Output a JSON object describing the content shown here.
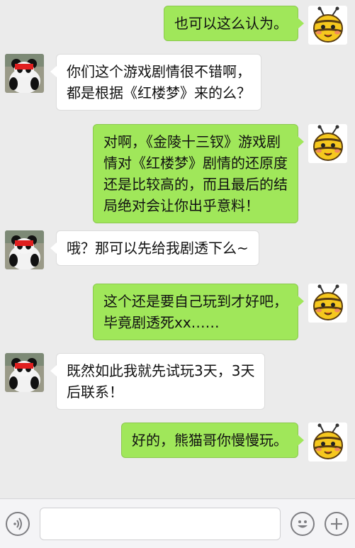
{
  "chat": {
    "messages": [
      {
        "side": "right",
        "sender": "bee",
        "text": "也可以这么认为。"
      },
      {
        "side": "left",
        "sender": "panda",
        "text": "你们这个游戏剧情很不错啊，\n都是根据《红楼梦》来的么？"
      },
      {
        "side": "right",
        "sender": "bee",
        "text": "对啊，《金陵十三钗》游戏剧\n情对《红楼梦》剧情的还原度\n还是比较高的，而且最后的结\n局绝对会让你出乎意料！"
      },
      {
        "side": "left",
        "sender": "panda",
        "text": "哦？那可以先给我剧透下么~"
      },
      {
        "side": "right",
        "sender": "bee",
        "text": "这个还是要自己玩到才好吧，\n毕竟剧透死xx……"
      },
      {
        "side": "left",
        "sender": "panda",
        "text": "既然如此我就先试玩3天，3天\n后联系！"
      },
      {
        "side": "right",
        "sender": "bee",
        "text": "好的，熊猫哥你慢慢玩。"
      }
    ]
  },
  "input_bar": {
    "voice_icon": "voice-icon",
    "input_value": "",
    "emoji_icon": "emoji-icon",
    "plus_icon": "plus-icon"
  },
  "colors": {
    "background": "#ebebeb",
    "sent_bubble": "#a0e75a",
    "received_bubble": "#ffffff"
  }
}
